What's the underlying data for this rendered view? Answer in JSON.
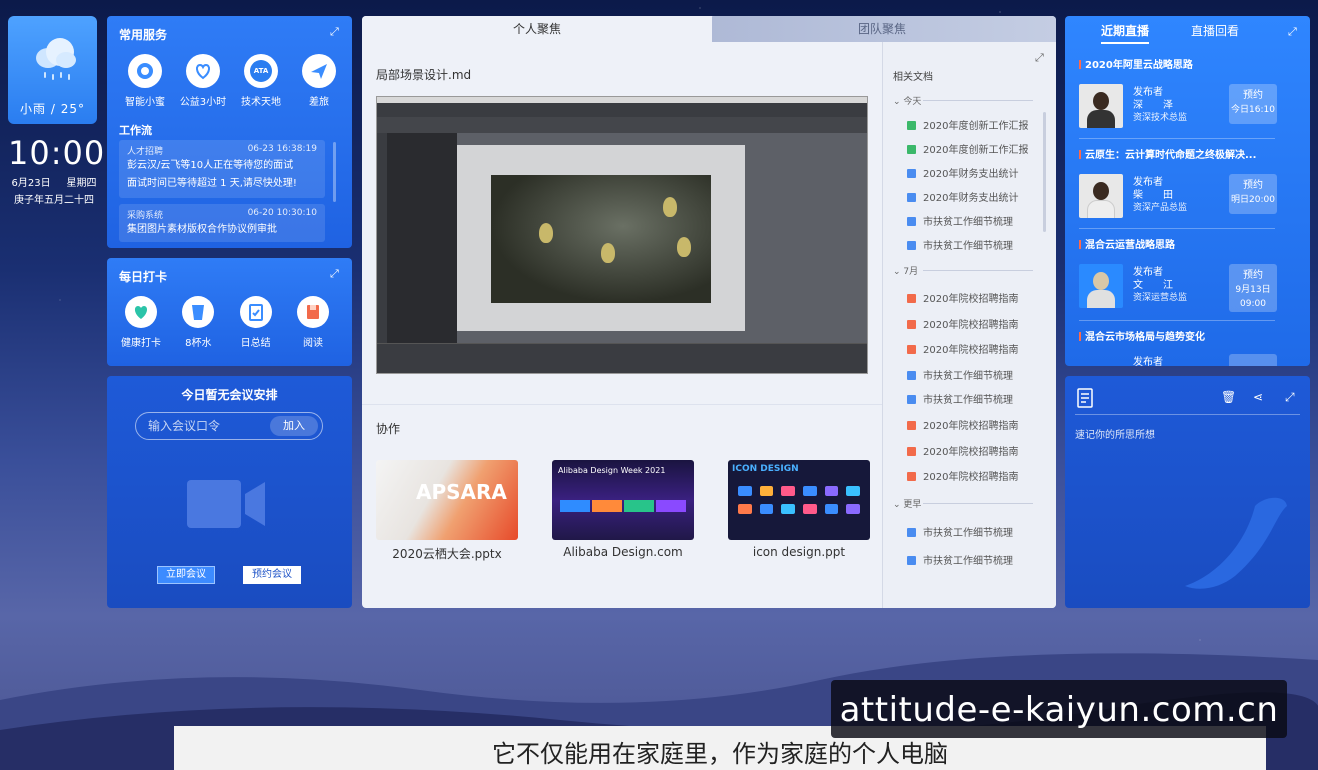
{
  "weather": {
    "text": "小雨 / 25°"
  },
  "clock": {
    "time": "10:00",
    "date": "6月23日",
    "weekday": "星期四",
    "lunar": "庚子年五月二十四"
  },
  "services": {
    "title": "常用服务",
    "items": [
      {
        "label": "智能小蜜",
        "icon": "robot-icon"
      },
      {
        "label": "公益3小时",
        "icon": "charity-icon"
      },
      {
        "label": "技术天地",
        "icon": "ata-icon",
        "glyph": "ATA"
      },
      {
        "label": "差旅",
        "icon": "airplane-icon"
      }
    ],
    "workflow_title": "工作流",
    "workflow": [
      {
        "source": "人才招聘",
        "time": "06-23 16:38:19",
        "lines": [
          "彭云汉/云飞等10人正在等待您的面试",
          "面试时间已等待超过 1 天,请尽快处理!"
        ]
      },
      {
        "source": "采购系统",
        "time": "06-20 10:30:10",
        "lines": [
          "集团图片素材版权合作协议例审批"
        ]
      }
    ]
  },
  "checkin": {
    "title": "每日打卡",
    "items": [
      {
        "label": "健康打卡",
        "icon": "heart-icon",
        "color": "#2bc4a8"
      },
      {
        "label": "8杯水",
        "icon": "cup-icon",
        "color": "#3a8dff"
      },
      {
        "label": "日总结",
        "icon": "checklist-icon",
        "color": "#3a8dff"
      },
      {
        "label": "阅读",
        "icon": "book-icon",
        "color": "#f26a4a"
      }
    ]
  },
  "meeting": {
    "title": "今日暂无会议安排",
    "input_placeholder": "输入会议口令",
    "join_label": "加入",
    "start_now": "立即会议",
    "schedule": "预约会议"
  },
  "center": {
    "tab_personal": "个人聚焦",
    "tab_team": "团队聚焦",
    "file_title": "局部场景设计.md",
    "collab_title": "协作",
    "thumbs": [
      {
        "label": "2020云栖大会.pptx",
        "art": "APSARA"
      },
      {
        "label": "Alibaba Design.com",
        "art": "Alibaba Design Week 2021"
      },
      {
        "label": "icon design.ppt",
        "art": "ICON DESIGN"
      }
    ]
  },
  "docs": {
    "title": "相关文档",
    "groups": [
      {
        "name": "今天",
        "items": [
          {
            "name": "2020年度创新工作汇报",
            "color": "#3bb86a"
          },
          {
            "name": "2020年度创新工作汇报",
            "color": "#3bb86a"
          },
          {
            "name": "2020年财务支出统计",
            "color": "#4a8cf0"
          },
          {
            "name": "2020年财务支出统计",
            "color": "#4a8cf0"
          },
          {
            "name": "市扶贫工作细节梳理",
            "color": "#4a8cf0"
          },
          {
            "name": "市扶贫工作细节梳理",
            "color": "#4a8cf0"
          }
        ]
      },
      {
        "name": "7月",
        "items": [
          {
            "name": "2020年院校招聘指南",
            "color": "#f26a4a"
          },
          {
            "name": "2020年院校招聘指南",
            "color": "#f26a4a"
          },
          {
            "name": "2020年院校招聘指南",
            "color": "#f26a4a"
          },
          {
            "name": "市扶贫工作细节梳理",
            "color": "#4a8cf0"
          },
          {
            "name": "市扶贫工作细节梳理",
            "color": "#4a8cf0"
          },
          {
            "name": "2020年院校招聘指南",
            "color": "#f26a4a"
          },
          {
            "name": "2020年院校招聘指南",
            "color": "#f26a4a"
          },
          {
            "name": "2020年院校招聘指南",
            "color": "#f26a4a"
          }
        ]
      },
      {
        "name": "更早",
        "items": [
          {
            "name": "市扶贫工作细节梳理",
            "color": "#4a8cf0"
          },
          {
            "name": "市扶贫工作细节梳理",
            "color": "#4a8cf0"
          }
        ]
      }
    ]
  },
  "live": {
    "tab_recent": "近期直播",
    "tab_replay": "直播回看",
    "items": [
      {
        "title": "2020年阿里云战略思路",
        "publisher": "发布者",
        "name": "深　　泽",
        "role": "资深技术总监",
        "btn": "预约",
        "time": "今日16:10"
      },
      {
        "title": "云原生：云计算时代命题之终极解决...",
        "publisher": "发布者",
        "name": "柴　　田",
        "role": "资深产品总监",
        "btn": "预约",
        "time": "明日20:00"
      },
      {
        "title": "混合云运营战略思路",
        "publisher": "发布者",
        "name": "文　　江",
        "role": "资深运营总监",
        "btn": "预约",
        "time": "9月13日 09:00"
      },
      {
        "title": "混合云市场格局与趋势变化",
        "publisher": "发布者",
        "name": "",
        "role": "",
        "btn": "",
        "time": ""
      }
    ]
  },
  "note": {
    "placeholder": "速记你的所思所想"
  },
  "subtitle": "它不仅能用在家庭里，作为家庭的个人电脑",
  "watermark": "attitude-e-kaiyun.com.cn"
}
